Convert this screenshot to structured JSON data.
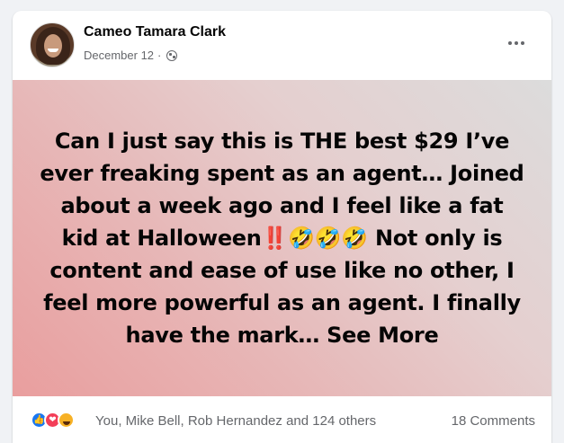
{
  "post": {
    "author": "Cameo Tamara Clark",
    "date": "December 12",
    "separator": "·",
    "audience_icon": "globe-icon",
    "text": "Can I just say this is THE best $29 I’ve ever freaking spent as an agent… Joined about a week ago and I feel like a fat kid at Halloween‼️🤣🤣🤣 Not only is content and ease of use like no other, I feel more powerful as an agent. I finally have the mark… See More",
    "background_colors": [
      "#e99e9e",
      "#dcdcdc"
    ]
  },
  "footer": {
    "reaction_icons": [
      "like-icon",
      "love-icon",
      "haha-icon"
    ],
    "reactors": "You, Mike Bell, Rob Hernandez and 124 others",
    "comments": "18 Comments"
  },
  "colors": {
    "secondary_text": "#65676b",
    "like": "#1877f2",
    "love": "#f33e58",
    "haha": "#f7b125"
  }
}
